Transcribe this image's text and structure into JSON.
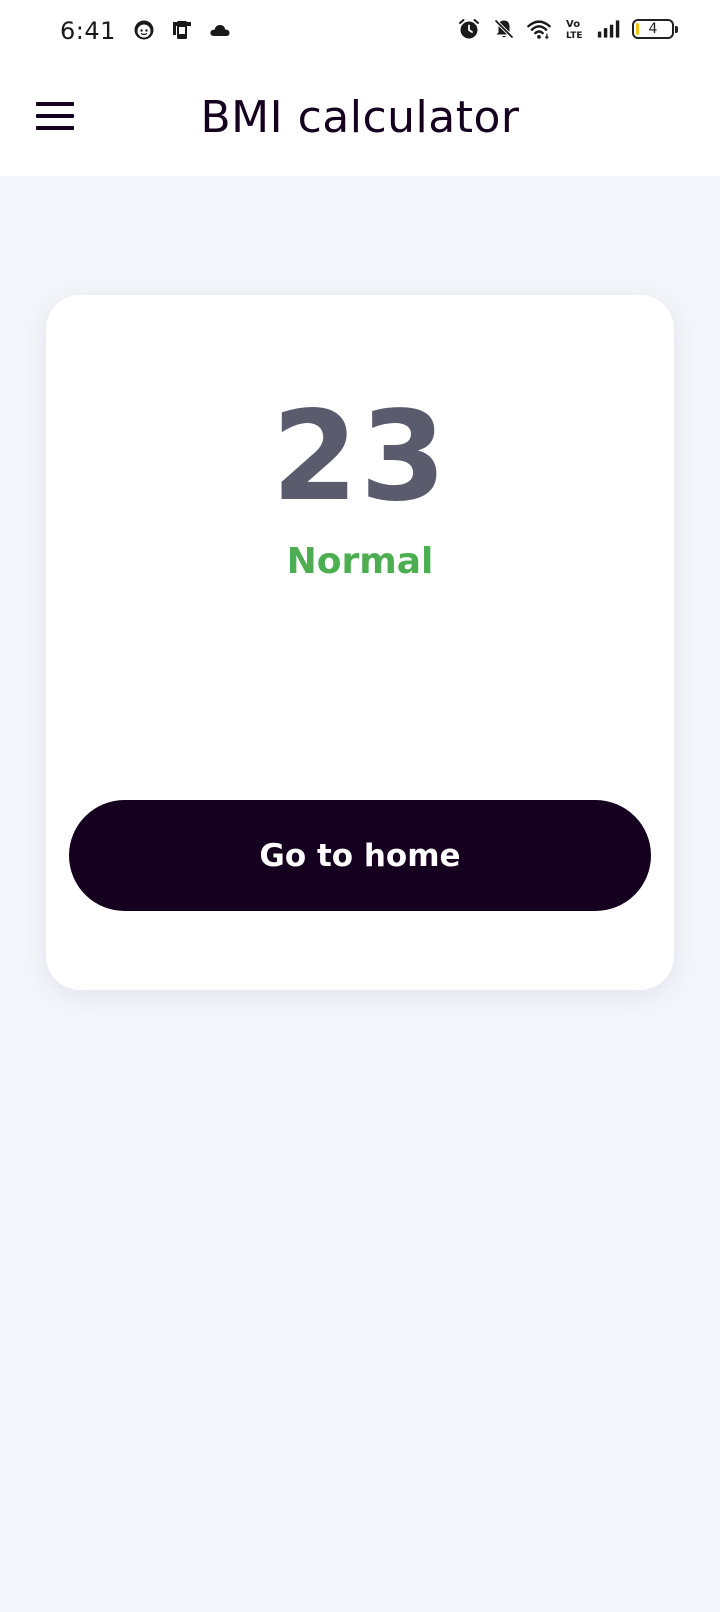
{
  "status_bar": {
    "time": "6:41",
    "battery_level": "4",
    "left_icons": [
      "face-notification-icon",
      "phone-transfer-icon",
      "cloud-icon"
    ],
    "right_icons": [
      "alarm-icon",
      "muted-bell-icon",
      "wifi-icon",
      "volte-icon",
      "signal-icon",
      "battery-icon"
    ]
  },
  "app_bar": {
    "title": "BMI calculator",
    "menu_icon": "hamburger-menu-icon"
  },
  "result": {
    "bmi_value": "23",
    "category": "Normal",
    "category_color": "#4cae50"
  },
  "actions": {
    "home_label": "Go to home"
  },
  "colors": {
    "primary_dark": "#15001f",
    "background": "#f5f6fb",
    "value_gray": "#5b5b6e"
  }
}
